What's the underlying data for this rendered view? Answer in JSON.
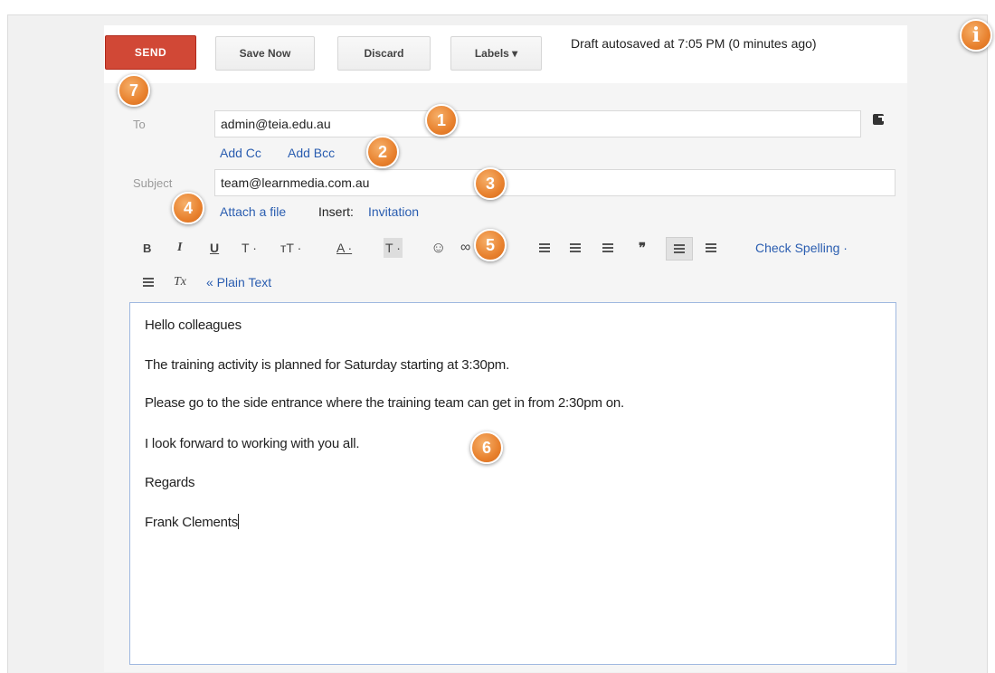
{
  "toolbar": {
    "send_label": "SEND",
    "save_label": "Save Now",
    "discard_label": "Discard",
    "labels_label": "Labels ▾",
    "status": "Draft autosaved at 7:05 PM (0 minutes ago)"
  },
  "to": {
    "label": "To",
    "value": "admin@teia.edu.au"
  },
  "cc_links": {
    "add_cc": "Add Cc",
    "add_bcc": "Add Bcc"
  },
  "subject": {
    "label": "Subject",
    "value": "team@learnmedia.com.au"
  },
  "attach": {
    "attach_label": "Attach a file",
    "insert_label": "Insert:",
    "invitation_label": "Invitation"
  },
  "formatting": {
    "bold": "B",
    "italic": "I",
    "underline": "U",
    "font": "T ·",
    "size": "тT ·",
    "text_color": "A ·",
    "highlight": "T ·",
    "emoji": "☺",
    "link": "∞",
    "quote": "❞",
    "check_spelling": "Check Spelling ·",
    "remove_format": "Tx",
    "plain_text": "« Plain Text"
  },
  "body_lines": [
    "Hello colleagues",
    "The training activity is planned for Saturday starting at 3:30pm.",
    "Please go to the side entrance where the training team can get in from 2:30pm on.",
    "I look forward to working with you all.",
    "Regards",
    "Frank Clements"
  ],
  "callouts": [
    "1",
    "2",
    "3",
    "4",
    "5",
    "6",
    "7"
  ],
  "info_badge": "i",
  "colors": {
    "send": "#d14836",
    "link": "#2a5db0",
    "callout": "#e8812e"
  }
}
